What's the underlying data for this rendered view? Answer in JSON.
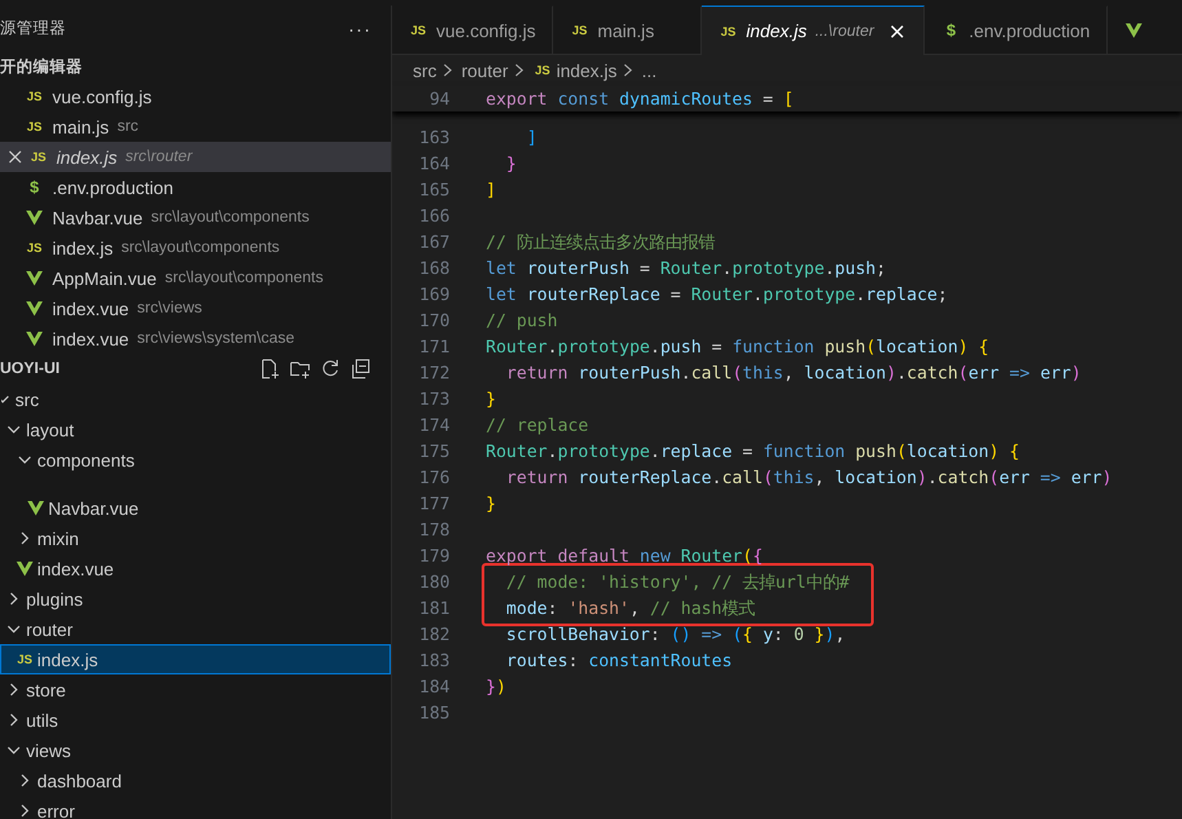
{
  "sidebar": {
    "title": "源管理器",
    "more": "···",
    "open_editors": {
      "title": "开的编辑器",
      "items": [
        {
          "name": "vue.config.js",
          "kind": "js",
          "icon": "JS",
          "selected": false,
          "preview": false
        },
        {
          "name": "main.js",
          "path": "src",
          "kind": "js",
          "icon": "JS",
          "selected": false,
          "preview": false
        },
        {
          "name": "index.js",
          "path": "src\\router",
          "kind": "js",
          "icon": "JS",
          "selected": true,
          "preview": true
        },
        {
          "name": ".env.production",
          "kind": "env",
          "icon": "$",
          "selected": false,
          "preview": false
        },
        {
          "name": "Navbar.vue",
          "path": "src\\layout\\components",
          "kind": "vue",
          "selected": false,
          "preview": false
        },
        {
          "name": "index.js",
          "path": "src\\layout\\components",
          "kind": "js",
          "icon": "JS",
          "selected": false,
          "preview": false
        },
        {
          "name": "AppMain.vue",
          "path": "src\\layout\\components",
          "kind": "vue",
          "selected": false,
          "preview": false
        },
        {
          "name": "index.vue",
          "path": "src\\views",
          "kind": "vue",
          "selected": false,
          "preview": false
        },
        {
          "name": "index.vue",
          "path": "src\\views\\system\\case",
          "kind": "vue",
          "selected": false,
          "preview": false
        }
      ]
    },
    "folder": {
      "title": "UOYI-UI",
      "tree": [
        {
          "label": "src",
          "kind": "folder",
          "expanded": true,
          "selected": false,
          "children": [
            {
              "label": "layout",
              "kind": "folder",
              "expanded": true,
              "selected": false,
              "children": [
                {
                  "label": "components",
                  "kind": "folder",
                  "expanded": true,
                  "selected": false,
                  "children": [
                    {
                      "label": "Navbar.vue",
                      "kind": "vue",
                      "selected": false
                    }
                  ]
                },
                {
                  "label": "mixin",
                  "kind": "folder",
                  "expanded": false,
                  "selected": false
                },
                {
                  "label": "index.vue",
                  "kind": "vue",
                  "selected": false
                }
              ]
            },
            {
              "label": "plugins",
              "kind": "folder",
              "expanded": false,
              "selected": false
            },
            {
              "label": "router",
              "kind": "folder",
              "expanded": true,
              "selected": false,
              "children": [
                {
                  "label": "index.js",
                  "kind": "js",
                  "icon": "JS",
                  "selected": true
                }
              ]
            },
            {
              "label": "store",
              "kind": "folder",
              "expanded": false,
              "selected": false
            },
            {
              "label": "utils",
              "kind": "folder",
              "expanded": false,
              "selected": false
            },
            {
              "label": "views",
              "kind": "folder",
              "expanded": true,
              "selected": false,
              "children": [
                {
                  "label": "dashboard",
                  "kind": "folder",
                  "expanded": false,
                  "selected": false
                },
                {
                  "label": "error",
                  "kind": "folder",
                  "expanded": false,
                  "selected": false
                }
              ]
            }
          ]
        }
      ]
    }
  },
  "tabs": [
    {
      "label": "vue.config.js",
      "kind": "js",
      "icon": "JS",
      "selected": false,
      "preview": false
    },
    {
      "label": "main.js",
      "kind": "js",
      "icon": "JS",
      "selected": false,
      "preview": false
    },
    {
      "label": "index.js",
      "description": "...\\router",
      "kind": "js",
      "icon": "JS",
      "selected": true,
      "preview": true
    },
    {
      "label": ".env.production",
      "kind": "env",
      "icon": "$",
      "selected": false,
      "preview": false
    },
    {
      "kind": "vue",
      "selected": false
    }
  ],
  "breadcrumbs": [
    {
      "label": "src"
    },
    {
      "label": "router"
    },
    {
      "label": "index.js",
      "kind": "js",
      "icon": "JS"
    },
    {
      "label": "..."
    }
  ],
  "editor": {
    "sticky": {
      "number": "94",
      "tokens": [
        {
          "text": "export",
          "kind": "kw"
        },
        {
          "text": " const",
          "kind": "st"
        },
        {
          "text": " dynamicRoutes",
          "kind": "const"
        },
        {
          "text": " =",
          "kind": "op"
        },
        {
          "text": " [",
          "kind": "b1"
        }
      ]
    },
    "lines": [
      {
        "kind": "line",
        "number": "163",
        "tokens": [
          {
            "text": "    ]",
            "kind": "b3"
          }
        ]
      },
      {
        "kind": "line",
        "number": "164",
        "tokens": [
          {
            "text": "  }",
            "kind": "b2"
          }
        ]
      },
      {
        "kind": "line",
        "number": "165",
        "tokens": [
          {
            "text": "]",
            "kind": "b1"
          }
        ]
      },
      {
        "kind": "line",
        "number": "166"
      },
      {
        "kind": "line",
        "number": "167",
        "tokens": [
          {
            "text": "// 防止连续点击多次路由报错",
            "kind": "cmt"
          }
        ]
      },
      {
        "kind": "line",
        "number": "168",
        "tokens": [
          {
            "text": "let",
            "kind": "st"
          },
          {
            "text": " routerPush",
            "kind": "var"
          },
          {
            "text": " =",
            "kind": "op"
          },
          {
            "text": " Router",
            "kind": "cls"
          },
          {
            "text": ".",
            "kind": "op"
          },
          {
            "text": "prototype",
            "kind": "prop"
          },
          {
            "text": ".",
            "kind": "op"
          },
          {
            "text": "push",
            "kind": "var"
          },
          {
            "text": ";",
            "kind": "op"
          }
        ]
      },
      {
        "kind": "line",
        "number": "169",
        "tokens": [
          {
            "text": "let",
            "kind": "st"
          },
          {
            "text": " routerReplace",
            "kind": "var"
          },
          {
            "text": " =",
            "kind": "op"
          },
          {
            "text": " Router",
            "kind": "cls"
          },
          {
            "text": ".",
            "kind": "op"
          },
          {
            "text": "prototype",
            "kind": "prop"
          },
          {
            "text": ".",
            "kind": "op"
          },
          {
            "text": "replace",
            "kind": "var"
          },
          {
            "text": ";",
            "kind": "op"
          }
        ]
      },
      {
        "kind": "line",
        "number": "170",
        "tokens": [
          {
            "text": "// push",
            "kind": "cmt"
          }
        ]
      },
      {
        "kind": "line",
        "number": "171",
        "tokens": [
          {
            "text": "Router",
            "kind": "cls"
          },
          {
            "text": ".",
            "kind": "op"
          },
          {
            "text": "prototype",
            "kind": "prop"
          },
          {
            "text": ".",
            "kind": "op"
          },
          {
            "text": "push",
            "kind": "var"
          },
          {
            "text": " =",
            "kind": "op"
          },
          {
            "text": " function",
            "kind": "st"
          },
          {
            "text": " push",
            "kind": "fn"
          },
          {
            "text": "(",
            "kind": "b1"
          },
          {
            "text": "location",
            "kind": "var"
          },
          {
            "text": ")",
            "kind": "b1"
          },
          {
            "text": " {",
            "kind": "b1"
          }
        ]
      },
      {
        "kind": "line",
        "number": "172",
        "tokens": [
          {
            "text": "  return",
            "kind": "kw"
          },
          {
            "text": " routerPush",
            "kind": "var"
          },
          {
            "text": ".",
            "kind": "op"
          },
          {
            "text": "call",
            "kind": "fn"
          },
          {
            "text": "(",
            "kind": "b2"
          },
          {
            "text": "this",
            "kind": "st"
          },
          {
            "text": ",",
            "kind": "op"
          },
          {
            "text": " location",
            "kind": "var"
          },
          {
            "text": ")",
            "kind": "b2"
          },
          {
            "text": ".",
            "kind": "op"
          },
          {
            "text": "catch",
            "kind": "fn"
          },
          {
            "text": "(",
            "kind": "b2"
          },
          {
            "text": "err",
            "kind": "var"
          },
          {
            "text": " =>",
            "kind": "st"
          },
          {
            "text": " err",
            "kind": "var"
          },
          {
            "text": ")",
            "kind": "b2"
          }
        ]
      },
      {
        "kind": "line",
        "number": "173",
        "tokens": [
          {
            "text": "}",
            "kind": "b1"
          }
        ]
      },
      {
        "kind": "line",
        "number": "174",
        "tokens": [
          {
            "text": "// replace",
            "kind": "cmt"
          }
        ]
      },
      {
        "kind": "line",
        "number": "175",
        "tokens": [
          {
            "text": "Router",
            "kind": "cls"
          },
          {
            "text": ".",
            "kind": "op"
          },
          {
            "text": "prototype",
            "kind": "prop"
          },
          {
            "text": ".",
            "kind": "op"
          },
          {
            "text": "replace",
            "kind": "var"
          },
          {
            "text": " =",
            "kind": "op"
          },
          {
            "text": " function",
            "kind": "st"
          },
          {
            "text": " push",
            "kind": "fn"
          },
          {
            "text": "(",
            "kind": "b1"
          },
          {
            "text": "location",
            "kind": "var"
          },
          {
            "text": ")",
            "kind": "b1"
          },
          {
            "text": " {",
            "kind": "b1"
          }
        ]
      },
      {
        "kind": "line",
        "number": "176",
        "tokens": [
          {
            "text": "  return",
            "kind": "kw"
          },
          {
            "text": " routerReplace",
            "kind": "var"
          },
          {
            "text": ".",
            "kind": "op"
          },
          {
            "text": "call",
            "kind": "fn"
          },
          {
            "text": "(",
            "kind": "b2"
          },
          {
            "text": "this",
            "kind": "st"
          },
          {
            "text": ",",
            "kind": "op"
          },
          {
            "text": " location",
            "kind": "var"
          },
          {
            "text": ")",
            "kind": "b2"
          },
          {
            "text": ".",
            "kind": "op"
          },
          {
            "text": "catch",
            "kind": "fn"
          },
          {
            "text": "(",
            "kind": "b2"
          },
          {
            "text": "err",
            "kind": "var"
          },
          {
            "text": " =>",
            "kind": "st"
          },
          {
            "text": " err",
            "kind": "var"
          },
          {
            "text": ")",
            "kind": "b2"
          }
        ]
      },
      {
        "kind": "line",
        "number": "177",
        "tokens": [
          {
            "text": "}",
            "kind": "b1"
          }
        ]
      },
      {
        "kind": "line",
        "number": "178"
      },
      {
        "kind": "line",
        "number": "179",
        "tokens": [
          {
            "text": "export",
            "kind": "kw"
          },
          {
            "text": " default",
            "kind": "kw"
          },
          {
            "text": " new",
            "kind": "st"
          },
          {
            "text": " Router",
            "kind": "cls"
          },
          {
            "text": "(",
            "kind": "b1"
          },
          {
            "text": "{",
            "kind": "b2"
          }
        ]
      },
      {
        "kind": "frame",
        "lines": [
          {
            "number": "180",
            "tokens": [
              {
                "text": "  // mode: 'history', // 去掉url中的#",
                "kind": "cmt"
              }
            ]
          },
          {
            "number": "181",
            "tokens": [
              {
                "text": "  mode",
                "kind": "var"
              },
              {
                "text": ":",
                "kind": "op"
              },
              {
                "text": " 'hash'",
                "kind": "str"
              },
              {
                "text": ",",
                "kind": "op"
              },
              {
                "text": " // hash模式",
                "kind": "cmt"
              }
            ]
          }
        ]
      },
      {
        "kind": "line",
        "number": "182",
        "tokens": [
          {
            "text": "  scrollBehavior",
            "kind": "var"
          },
          {
            "text": ":",
            "kind": "op"
          },
          {
            "text": " ()",
            "kind": "b3"
          },
          {
            "text": " =>",
            "kind": "st"
          },
          {
            "text": " (",
            "kind": "b3"
          },
          {
            "text": "{",
            "kind": "b1"
          },
          {
            "text": " y",
            "kind": "var"
          },
          {
            "text": ":",
            "kind": "op"
          },
          {
            "text": " 0",
            "kind": "num"
          },
          {
            "text": " }",
            "kind": "b1"
          },
          {
            "text": ")",
            "kind": "b3"
          },
          {
            "text": ",",
            "kind": "op"
          }
        ]
      },
      {
        "kind": "line",
        "number": "183",
        "tokens": [
          {
            "text": "  routes",
            "kind": "var"
          },
          {
            "text": ":",
            "kind": "op"
          },
          {
            "text": " constantRoutes",
            "kind": "const"
          }
        ]
      },
      {
        "kind": "line",
        "number": "184",
        "tokens": [
          {
            "text": "}",
            "kind": "b2"
          },
          {
            "text": ")",
            "kind": "b1"
          }
        ]
      },
      {
        "kind": "line",
        "number": "185"
      }
    ]
  }
}
